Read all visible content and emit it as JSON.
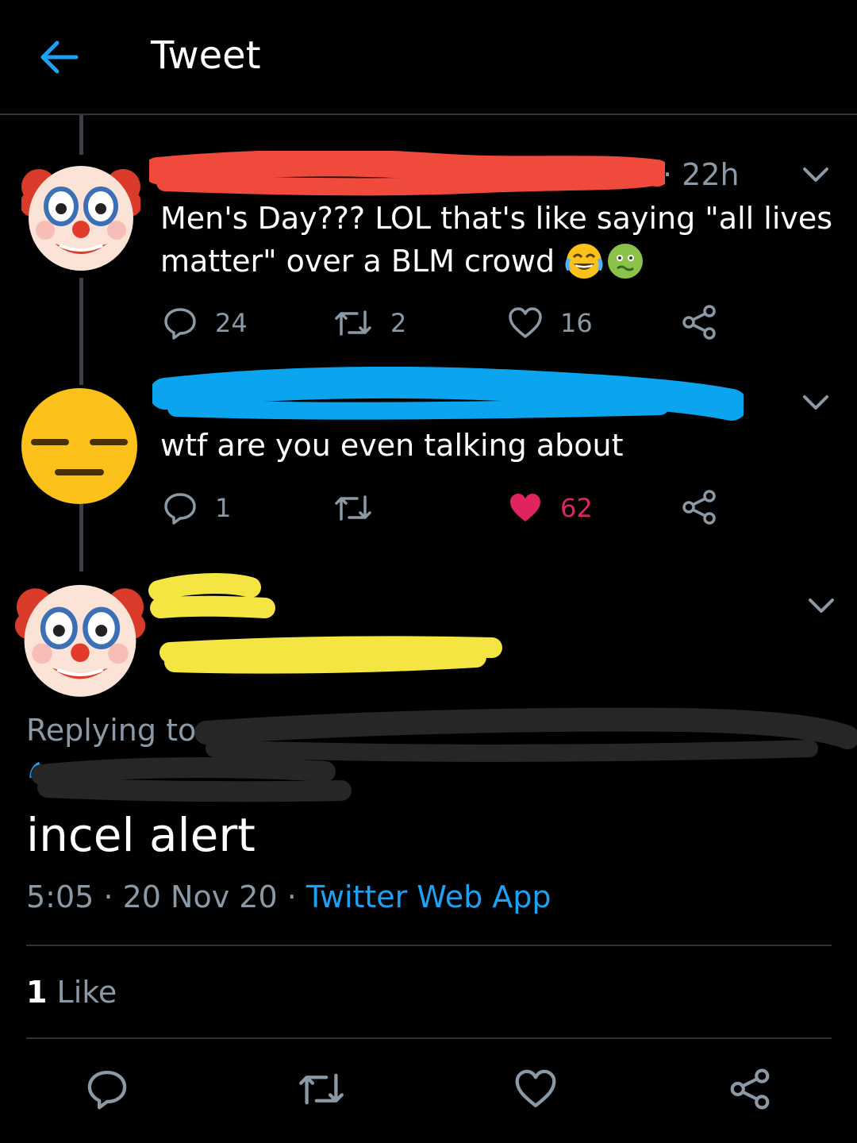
{
  "header": {
    "title": "Tweet"
  },
  "tweet1": {
    "time": "· 22h",
    "text_line1": "Men's Day??? LOL that's like saying \"all lives",
    "text_line2": "matter\" over a BLM crowd",
    "emojis": [
      "face-with-tears-of-joy",
      "nauseated-face"
    ],
    "replies": "24",
    "retweets": "2",
    "likes": "16",
    "redaction_color": "#f04a3c"
  },
  "tweet2": {
    "text": "wtf are you even talking about",
    "replies": "1",
    "retweets": "",
    "likes": "62",
    "liked": true,
    "redaction_color": "#0aa4ef"
  },
  "main_tweet": {
    "replying_label": "Replying to",
    "text": "incel alert",
    "time": "5:05",
    "date": "20 Nov 20",
    "separator": "·",
    "source": "Twitter Web App",
    "likes_count": "1",
    "likes_label": "Like",
    "redaction_color": "#f4e542"
  },
  "colors": {
    "background": "#000000",
    "accent": "#1da1f2",
    "like": "#e0245e",
    "muted": "#8b98a5"
  }
}
